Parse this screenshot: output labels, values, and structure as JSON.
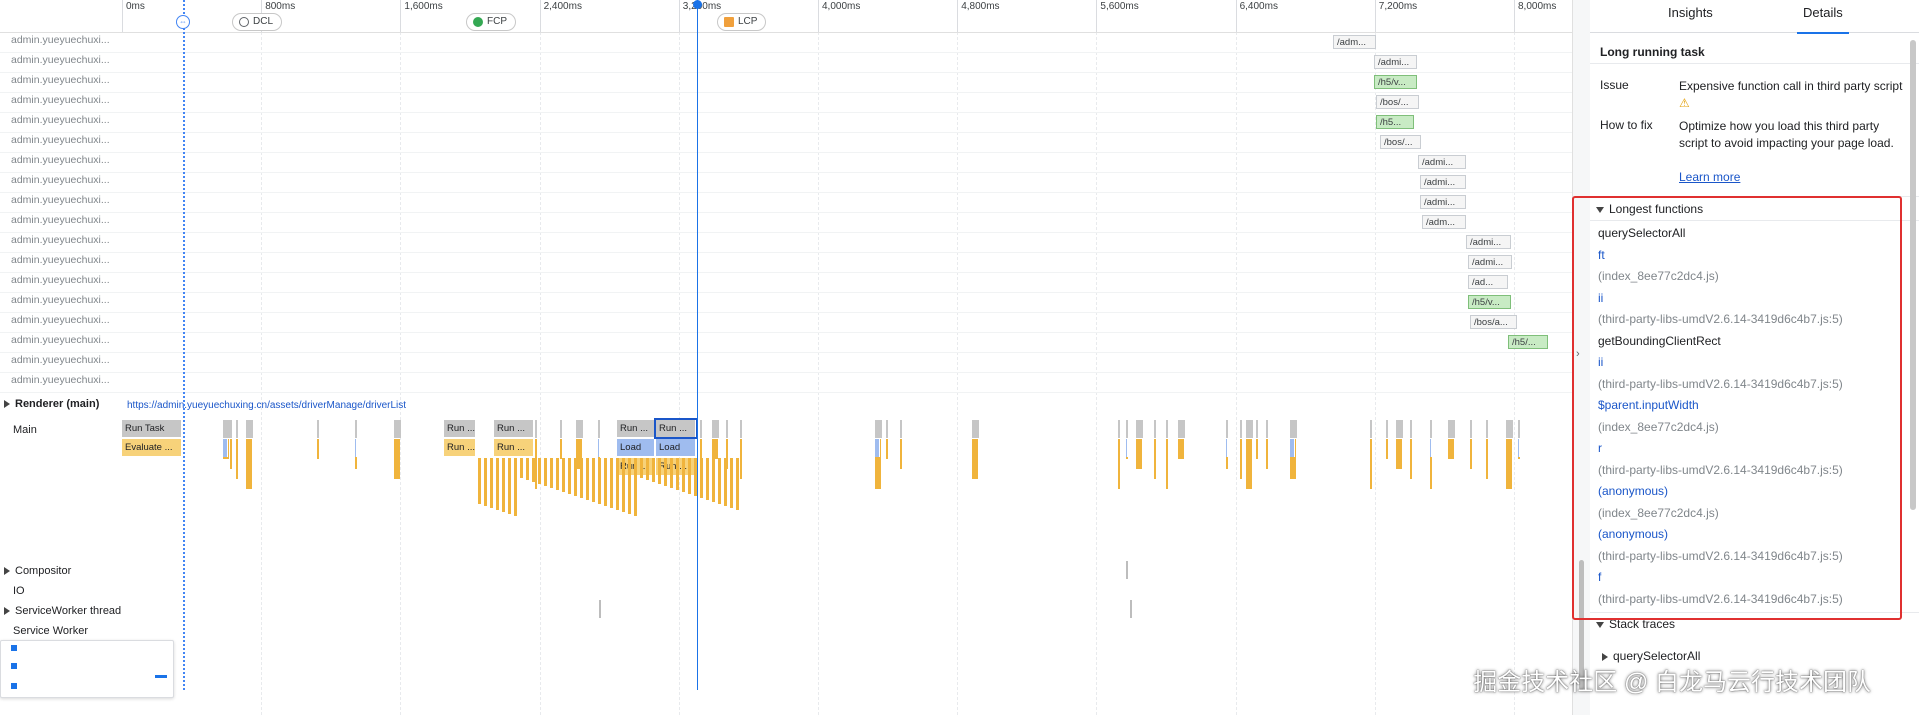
{
  "ruler": {
    "ticks": [
      "0ms",
      "800ms",
      "1,600ms",
      "2,400ms",
      "3,200ms",
      "4,000ms",
      "4,800ms",
      "5,600ms",
      "6,400ms",
      "7,200ms",
      "8,000ms"
    ],
    "markers": {
      "dcl": "DCL",
      "fcp": "FCP",
      "lcp": "LCP"
    }
  },
  "network": {
    "lane_label": "admin.yueyuechuxi...",
    "requests": [
      "/adm...",
      "/admi...",
      "/h5/v...",
      "/bos/...",
      "/h5...",
      "/bos/...",
      "/admi...",
      "/admi...",
      "/admi...",
      "/adm...",
      "/admi...",
      "/admi...",
      "/ad...",
      "/h5/v...",
      "/bos/a...",
      "/h5/..."
    ]
  },
  "renderer": {
    "title": "Renderer (main)",
    "url": "https://admin.yueyuechuxing.cn/assets/driverManage/driverList",
    "main_label": "Main",
    "run_task": "Run Task",
    "evaluate": "Evaluate ...",
    "run_short": "Run ...",
    "load": "Load"
  },
  "tracks": {
    "compositor": "Compositor",
    "io": "IO",
    "service_worker_thread": "ServiceWorker thread",
    "service_worker": "Service Worker"
  },
  "panel": {
    "tabs": [
      "Insights",
      "Details"
    ],
    "title": "Long running task",
    "issue_label": "Issue",
    "issue_value": "Expensive function call in third party script",
    "howto_label": "How to fix",
    "howto_value": "Optimize how you load this third party script to avoid impacting your page load.",
    "learn_more": "Learn more",
    "longest_functions": "Longest functions",
    "functions": [
      {
        "t": "name",
        "v": "querySelectorAll"
      },
      {
        "t": "link",
        "v": "ft"
      },
      {
        "t": "src",
        "v": "(index_8ee77c2dc4.js)"
      },
      {
        "t": "link",
        "v": "ii"
      },
      {
        "t": "src",
        "v": "(third-party-libs-umdV2.6.14-3419d6c4b7.js:5)"
      },
      {
        "t": "name",
        "v": "getBoundingClientRect"
      },
      {
        "t": "link",
        "v": "ii"
      },
      {
        "t": "src",
        "v": "(third-party-libs-umdV2.6.14-3419d6c4b7.js:5)"
      },
      {
        "t": "link",
        "v": "$parent.inputWidth"
      },
      {
        "t": "src",
        "v": "(index_8ee77c2dc4.js)"
      },
      {
        "t": "link",
        "v": "r"
      },
      {
        "t": "src",
        "v": "(third-party-libs-umdV2.6.14-3419d6c4b7.js:5)"
      },
      {
        "t": "link",
        "v": "(anonymous)"
      },
      {
        "t": "src",
        "v": "(index_8ee77c2dc4.js)"
      },
      {
        "t": "link",
        "v": "(anonymous)"
      },
      {
        "t": "src",
        "v": "(third-party-libs-umdV2.6.14-3419d6c4b7.js:5)"
      },
      {
        "t": "link",
        "v": "f"
      },
      {
        "t": "src",
        "v": "(third-party-libs-umdV2.6.14-3419d6c4b7.js:5)"
      }
    ],
    "stack_traces": "Stack traces",
    "stack_item": "querySelectorAll"
  },
  "watermark": "掘金技术社区 @ 白龙马云行技术团队",
  "colors": {
    "accent": "#1a73e8",
    "highlight": "#e03030",
    "task": "#c6c6c6",
    "script": "#f7d27a",
    "load": "#9fbcef"
  }
}
